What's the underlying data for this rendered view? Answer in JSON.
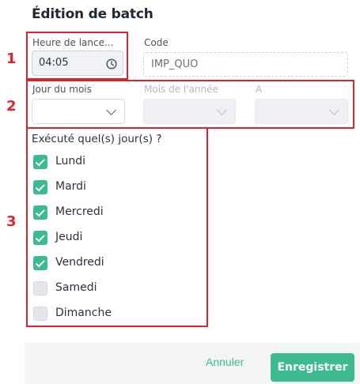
{
  "dialog": {
    "title": "Édition de batch"
  },
  "time_field": {
    "label": "Heure de lance...",
    "value": "04:05",
    "icon": "clock-icon"
  },
  "code_field": {
    "label": "Code",
    "value": "IMP_QUO"
  },
  "schedule": {
    "day_of_month": {
      "label": "Jour du mois",
      "value": ""
    },
    "month_of_year": {
      "label": "Mois de l'année",
      "value": ""
    },
    "year": {
      "label": "A",
      "value": ""
    }
  },
  "weekdays": {
    "label": "Exécuté quel(s) jour(s) ?",
    "days": [
      {
        "label": "Lundi",
        "checked": true
      },
      {
        "label": "Mardi",
        "checked": true
      },
      {
        "label": "Mercredi",
        "checked": true
      },
      {
        "label": "Jeudi",
        "checked": true
      },
      {
        "label": "Vendredi",
        "checked": true
      },
      {
        "label": "Samedi",
        "checked": false
      },
      {
        "label": "Dimanche",
        "checked": false
      }
    ]
  },
  "annotations": {
    "one": "1",
    "two": "2",
    "three": "3",
    "color": "#d9252e"
  },
  "footer": {
    "cancel_label": "Annuler",
    "save_label": "Enregistrer",
    "accent": "#3dbb8f"
  }
}
